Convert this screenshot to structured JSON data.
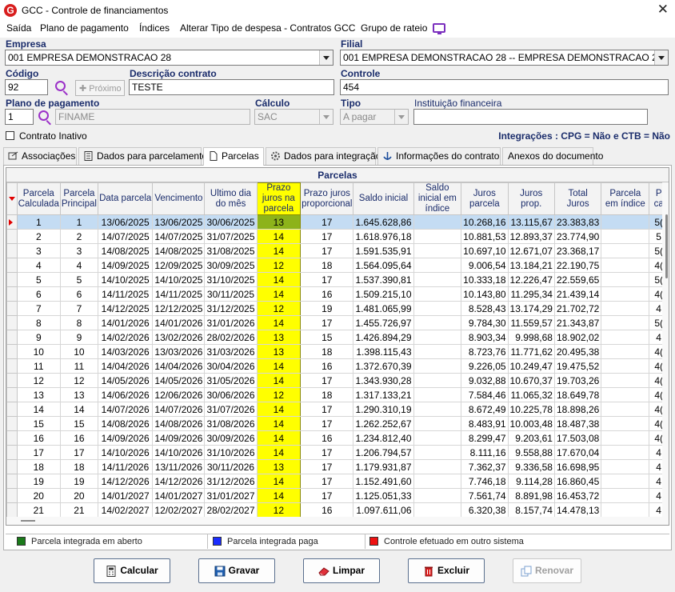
{
  "window": {
    "title": "GCC - Controle de financiamentos",
    "close": "✕"
  },
  "menu": [
    "Saída",
    "Plano de pagamento",
    "Índices",
    "Alterar Tipo de despesa - Contratos GCC",
    "Grupo de rateio"
  ],
  "form": {
    "empresa_label": "Empresa",
    "empresa_value": "001 EMPRESA DEMONSTRACAO 28",
    "filial_label": "Filial",
    "filial_value": "001 EMPRESA DEMONSTRACAO 28 -- EMPRESA DEMONSTRACAO 28",
    "codigo_label": "Código",
    "codigo_value": "92",
    "proximo_label": "Próximo",
    "descricao_label": "Descrição contrato",
    "descricao_value": "TESTE",
    "controle_label": "Controle",
    "controle_value": "454",
    "plano_label": "Plano de pagamento",
    "plano_code": "1",
    "plano_name": "FINAME",
    "calculo_label": "Cálculo",
    "calculo_value": "SAC",
    "tipo_label": "Tipo",
    "tipo_value": "A pagar",
    "instituicao_label": "Instituição financeira",
    "instituicao_value": "",
    "contrato_inativo_label": "Contrato Inativo",
    "integracoes_text": "Integrações : CPG = Não e CTB = Não"
  },
  "tabs": [
    "Associações",
    "Dados para parcelamento",
    "Parcelas",
    "Dados para integração",
    "Informações do contrato",
    "Anexos do documento"
  ],
  "grid": {
    "title": "Parcelas",
    "headers": [
      "Parcela Calculada",
      "Parcela Principal",
      "Data parcela",
      "Vencimento",
      "Ultimo dia do mês",
      "Prazo juros na parcela",
      "Prazo juros proporcional",
      "Saldo inicial",
      "Saldo inicial em índice",
      "Juros parcela",
      "Juros prop.",
      "Total Juros",
      "Parcela em índice",
      "P ca"
    ],
    "rows": [
      [
        "1",
        "1",
        "13/06/2025",
        "13/06/2025",
        "30/06/2025",
        "13",
        "17",
        "1.645.628,86",
        "",
        "10.268,16",
        "13.115,67",
        "23.383,83",
        "",
        "5("
      ],
      [
        "2",
        "2",
        "14/07/2025",
        "14/07/2025",
        "31/07/2025",
        "14",
        "17",
        "1.618.976,18",
        "",
        "10.881,53",
        "12.893,37",
        "23.774,90",
        "",
        "5"
      ],
      [
        "3",
        "3",
        "14/08/2025",
        "14/08/2025",
        "31/08/2025",
        "14",
        "17",
        "1.591.535,91",
        "",
        "10.697,10",
        "12.671,07",
        "23.368,17",
        "",
        "5("
      ],
      [
        "4",
        "4",
        "14/09/2025",
        "12/09/2025",
        "30/09/2025",
        "12",
        "18",
        "1.564.095,64",
        "",
        "9.006,54",
        "13.184,21",
        "22.190,75",
        "",
        "4("
      ],
      [
        "5",
        "5",
        "14/10/2025",
        "14/10/2025",
        "31/10/2025",
        "14",
        "17",
        "1.537.390,81",
        "",
        "10.333,18",
        "12.226,47",
        "22.559,65",
        "",
        "5("
      ],
      [
        "6",
        "6",
        "14/11/2025",
        "14/11/2025",
        "30/11/2025",
        "14",
        "16",
        "1.509.215,10",
        "",
        "10.143,80",
        "11.295,34",
        "21.439,14",
        "",
        "4("
      ],
      [
        "7",
        "7",
        "14/12/2025",
        "12/12/2025",
        "31/12/2025",
        "12",
        "19",
        "1.481.065,99",
        "",
        "8.528,43",
        "13.174,29",
        "21.702,72",
        "",
        "4"
      ],
      [
        "8",
        "8",
        "14/01/2026",
        "14/01/2026",
        "31/01/2026",
        "14",
        "17",
        "1.455.726,97",
        "",
        "9.784,30",
        "11.559,57",
        "21.343,87",
        "",
        "5("
      ],
      [
        "9",
        "9",
        "14/02/2026",
        "13/02/2026",
        "28/02/2026",
        "13",
        "15",
        "1.426.894,29",
        "",
        "8.903,34",
        "9.998,68",
        "18.902,02",
        "",
        "4"
      ],
      [
        "10",
        "10",
        "14/03/2026",
        "13/03/2026",
        "31/03/2026",
        "13",
        "18",
        "1.398.115,43",
        "",
        "8.723,76",
        "11.771,62",
        "20.495,38",
        "",
        "4("
      ],
      [
        "11",
        "11",
        "14/04/2026",
        "14/04/2026",
        "30/04/2026",
        "14",
        "16",
        "1.372.670,39",
        "",
        "9.226,05",
        "10.249,47",
        "19.475,52",
        "",
        "4("
      ],
      [
        "12",
        "12",
        "14/05/2026",
        "14/05/2026",
        "31/05/2026",
        "14",
        "17",
        "1.343.930,28",
        "",
        "9.032,88",
        "10.670,37",
        "19.703,26",
        "",
        "4("
      ],
      [
        "13",
        "13",
        "14/06/2026",
        "12/06/2026",
        "30/06/2026",
        "12",
        "18",
        "1.317.133,21",
        "",
        "7.584,46",
        "11.065,32",
        "18.649,78",
        "",
        "4("
      ],
      [
        "14",
        "14",
        "14/07/2026",
        "14/07/2026",
        "31/07/2026",
        "14",
        "17",
        "1.290.310,19",
        "",
        "8.672,49",
        "10.225,78",
        "18.898,26",
        "",
        "4("
      ],
      [
        "15",
        "15",
        "14/08/2026",
        "14/08/2026",
        "31/08/2026",
        "14",
        "17",
        "1.262.252,67",
        "",
        "8.483,91",
        "10.003,48",
        "18.487,38",
        "",
        "4("
      ],
      [
        "16",
        "16",
        "14/09/2026",
        "14/09/2026",
        "30/09/2026",
        "14",
        "16",
        "1.234.812,40",
        "",
        "8.299,47",
        "9.203,61",
        "17.503,08",
        "",
        "4("
      ],
      [
        "17",
        "17",
        "14/10/2026",
        "14/10/2026",
        "31/10/2026",
        "14",
        "17",
        "1.206.794,57",
        "",
        "8.111,16",
        "9.558,88",
        "17.670,04",
        "",
        "4"
      ],
      [
        "18",
        "18",
        "14/11/2026",
        "13/11/2026",
        "30/11/2026",
        "13",
        "17",
        "1.179.931,87",
        "",
        "7.362,37",
        "9.336,58",
        "16.698,95",
        "",
        "4"
      ],
      [
        "19",
        "19",
        "14/12/2026",
        "14/12/2026",
        "31/12/2026",
        "14",
        "17",
        "1.152.491,60",
        "",
        "7.746,18",
        "9.114,28",
        "16.860,45",
        "",
        "4"
      ],
      [
        "20",
        "20",
        "14/01/2027",
        "14/01/2027",
        "31/01/2027",
        "14",
        "17",
        "1.125.051,33",
        "",
        "7.561,74",
        "8.891,98",
        "16.453,72",
        "",
        "4"
      ],
      [
        "21",
        "21",
        "14/02/2027",
        "12/02/2027",
        "28/02/2027",
        "12",
        "16",
        "1.097.611,06",
        "",
        "6.320,38",
        "8.157,74",
        "14.478,13",
        "",
        "4"
      ]
    ]
  },
  "legend": [
    {
      "color": "#1a7a1a",
      "label": "Parcela integrada em aberto"
    },
    {
      "color": "#1a2cff",
      "label": "Parcela integrada paga"
    },
    {
      "color": "#ee1111",
      "label": "Controle efetuado em outro sistema"
    }
  ],
  "buttons": {
    "calcular": "Calcular",
    "gravar": "Gravar",
    "limpar": "Limpar",
    "excluir": "Excluir",
    "renovar": "Renovar"
  },
  "colors": {
    "highlight": "#ffff00",
    "selected_row": "#c4dcf3",
    "label_blue": "#1a2c6b",
    "accent_purple": "#9b30c8"
  }
}
